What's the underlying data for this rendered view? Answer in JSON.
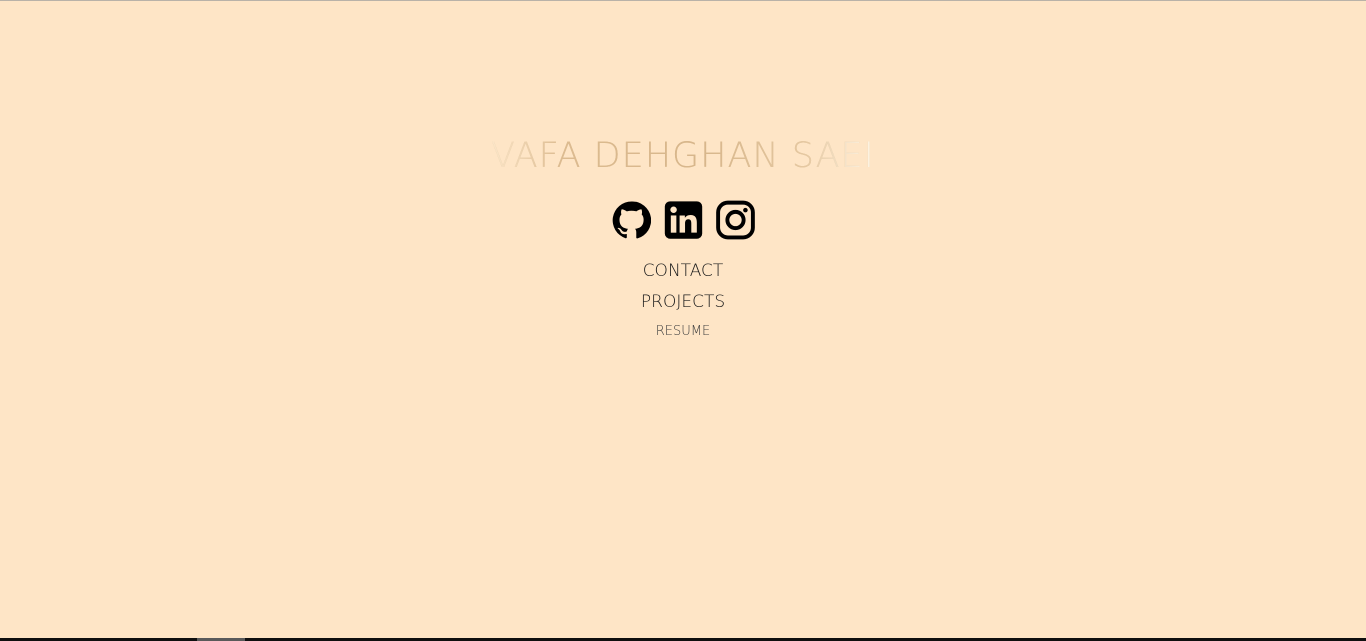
{
  "site": {
    "title": "VAFA DEHGHAN SAEI"
  },
  "social": [
    {
      "name": "github",
      "icon": "github-icon"
    },
    {
      "name": "linkedin",
      "icon": "linkedin-icon"
    },
    {
      "name": "instagram",
      "icon": "instagram-icon"
    }
  ],
  "nav": {
    "contact": "CONTACT",
    "projects": "PROJECTS",
    "resume": "RESUME"
  },
  "colors": {
    "background": "#fee5c6",
    "title": "#d9b98f",
    "icons": "#000000",
    "links": "#1a1a1a"
  }
}
